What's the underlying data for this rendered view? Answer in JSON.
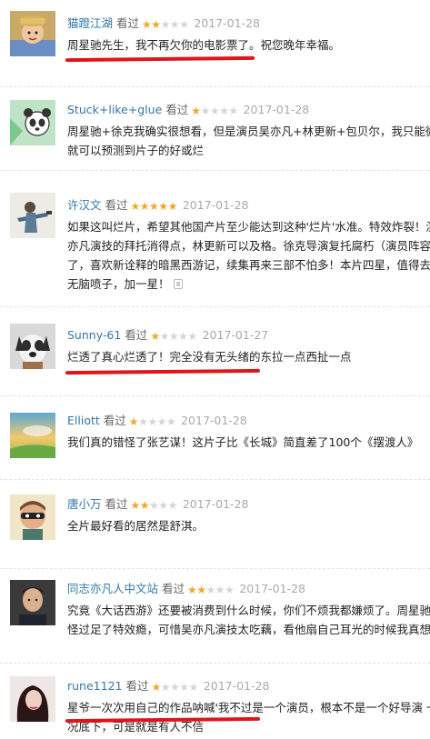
{
  "reviews": [
    {
      "user": "猫蹬江湖",
      "watched": "看过",
      "rating": 2,
      "date": "2017-01-28",
      "lines": [
        "周星驰先生，我不再欠你的电影票了。祝您晚年幸福。"
      ],
      "avatar": "child-in-hat-avatar"
    },
    {
      "user": "Stuck+like+glue",
      "watched": "看过",
      "rating": 1,
      "date": "2017-01-28",
      "lines": [
        "周星驰+徐克我确实很想看，但是演员吴亦凡+林更新+包贝尔，我只能微笑",
        "就可以预测到片子的好或烂"
      ],
      "avatar": "panda-cartoon-avatar"
    },
    {
      "user": "许汉文",
      "watched": "看过",
      "rating": 5,
      "date": "2017-01-28",
      "lines": [
        "如果这叫烂片，希望其他国产片至少能达到这种'烂片'水准。特效炸裂！演",
        "亦凡演技的拜托消得点，林更新可以及格。徐克导演复托腐朽（演员阵容）太",
        "了，喜欢新诠释的暗黑西游记，续集再来三部不怕多！本片四星，值得去影",
        "无脑喷子，加一星！"
      ],
      "avatar": "figure-pose-avatar"
    },
    {
      "user": "Sunny-61",
      "watched": "看过",
      "rating": 1,
      "date": "2017-01-27",
      "lines": [
        "烂透了真心烂透了！完全没有无头绪的东拉一点西扯一点"
      ],
      "avatar": "dog-avatar"
    },
    {
      "user": "Elliott",
      "watched": "看过",
      "rating": 1,
      "date": "2017-01-28",
      "lines": [
        "我们真的错怪了张艺谋！这片子比《长城》简直差了100个《摆渡人》"
      ],
      "avatar": "sunset-sky-avatar"
    },
    {
      "user": "唐小万",
      "watched": "看过",
      "rating": 2,
      "date": "2017-01-28",
      "lines": [
        "全片最好看的居然是舒淇。"
      ],
      "avatar": "masked-cartoon-avatar"
    },
    {
      "user": "同志亦凡人中文站",
      "watched": "看过",
      "rating": 2,
      "date": "2017-01-28",
      "lines": [
        "究竟《大话西游》还要被消费到什么时候，你们不烦我都嫌烦了。周星驰这",
        "怪过足了特效瘾，可惜吴亦凡演技太吃藕，看他扇自己耳光的时候我真想冲"
      ],
      "avatar": "man-portrait-avatar"
    },
    {
      "user": "rune1121",
      "watched": "看过",
      "rating": 1,
      "date": "2017-01-28",
      "lines": [
        "星爷一次次用自己的作品呐喊'我不过是一个演员，根本不是一个好导演 一",
        "况底下，可是就是有人不信"
      ],
      "avatar": "woman-portrait-avatar"
    }
  ]
}
